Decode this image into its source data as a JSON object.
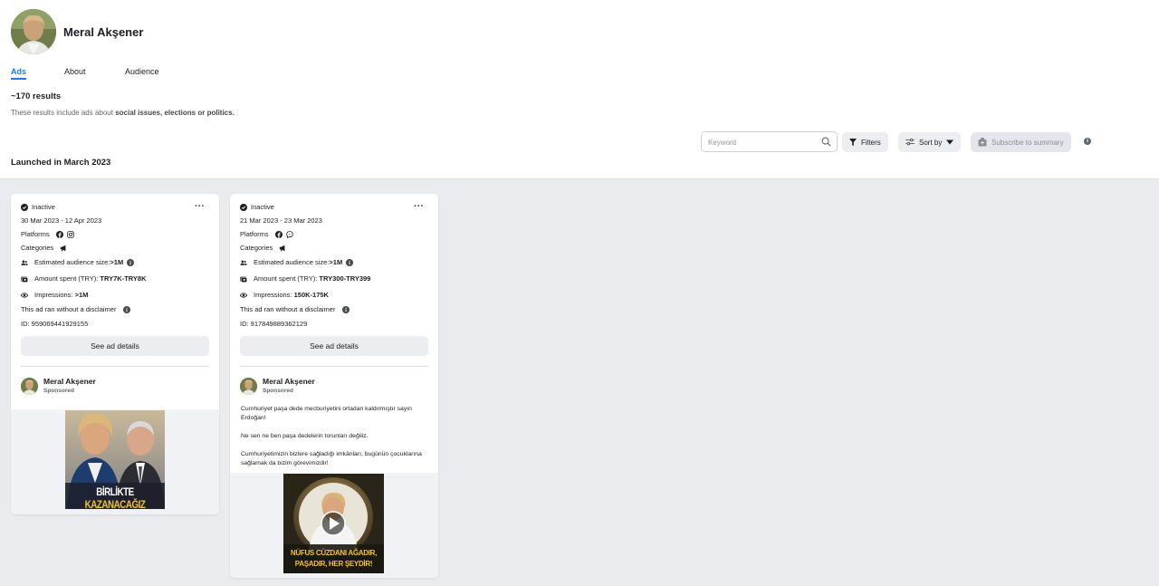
{
  "page": {
    "name": "Meral Akşener"
  },
  "tabs": [
    {
      "label": "Ads",
      "active": true
    },
    {
      "label": "About",
      "active": false
    },
    {
      "label": "Audience",
      "active": false
    }
  ],
  "results": {
    "count": "~170 results",
    "note_prefix": "These results include ads about ",
    "note_bold": "social issues, elections or politics."
  },
  "toolbar": {
    "search_placeholder": "Keyword",
    "filters_label": "Filters",
    "sort_label": "Sort by",
    "subscribe_label": "Subscribe to summary"
  },
  "section_title": "Launched in March 2023",
  "colors": {
    "accent": "#1877f2",
    "page_bg": "#e9ebee",
    "button_bg": "#ebedf0"
  },
  "cards": [
    {
      "status": "Inactive",
      "dates": "30 Mar 2023 - 12 Apr 2023",
      "platforms_label": "Platforms",
      "platforms": [
        "facebook-icon",
        "instagram-icon"
      ],
      "categories_label": "Categories",
      "audience_label": "Estimated audience size:",
      "audience_value": ">1M",
      "spent_label": "Amount spent (TRY): ",
      "spent_value": "TRY7K-TRY8K",
      "impressions_label": "Impressions: ",
      "impressions_value": ">1M",
      "disclaimer": "This ad ran without a disclaimer",
      "id": "ID: 959069441929155",
      "see_details": "See ad details",
      "advertiser": "Meral Akşener",
      "sponsored": "Sponsored",
      "image_caption_1": "BİRLİKTE ",
      "image_caption_2": "KAZANACAĞIZ"
    },
    {
      "status": "Inactive",
      "dates": "21 Mar 2023 - 23 Mar 2023",
      "platforms_label": "Platforms",
      "platforms": [
        "facebook-icon",
        "messenger-icon"
      ],
      "categories_label": "Categories",
      "audience_label": "Estimated audience size:",
      "audience_value": ">1M",
      "spent_label": "Amount spent (TRY): ",
      "spent_value": "TRY300-TRY399",
      "impressions_label": "Impressions: ",
      "impressions_value": "150K-175K",
      "disclaimer": "This ad ran without a disclaimer",
      "id": "ID: 917849889362129",
      "see_details": "See ad details",
      "advertiser": "Meral Akşener",
      "sponsored": "Sponsored",
      "text_1": "Cumhuriyet paşa dede mecburiyetini ortadan kaldırmıştır sayın Erdoğan!",
      "text_2": "Ne sen ne ben paşa dedelerin torunları değiliz.",
      "text_3": "Cumhuriyetimizin bizlere sağladığı imkânları, bugünün çocuklarına sağlamak da bizim görevimizdir!",
      "image_caption_1": "NÜFUS CÜZDANI AĞADIR,",
      "image_caption_2": "PAŞADIR, HER ŞEYDİR!"
    }
  ]
}
